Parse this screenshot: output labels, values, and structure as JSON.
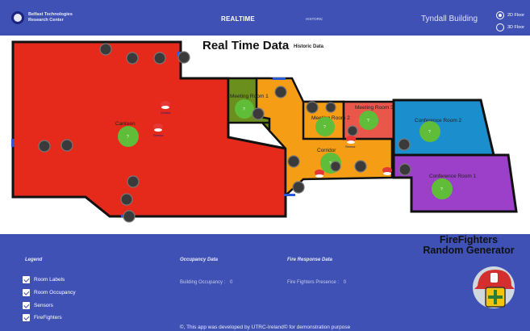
{
  "header": {
    "logo_text": "Belfast Technologies Research Center",
    "nav_realtime": "REALTIME",
    "nav_historic": "HISTORIC",
    "building": "Tyndall Building",
    "view_options": [
      {
        "label": "2D Floor",
        "selected": true
      },
      {
        "label": "3D Floor",
        "selected": false
      }
    ]
  },
  "map": {
    "title": "Real Time Data",
    "subtitle": "Historic Data",
    "rooms": {
      "canteen": {
        "label": "Canteen",
        "color": "#e52a1c"
      },
      "meeting1": {
        "label": "Meeting Room 1",
        "color": "#6a8f1c"
      },
      "meeting2": {
        "label": "Meeting Room 2",
        "color": "#f59d14"
      },
      "meeting3": {
        "label": "Meeting Room 3",
        "color": "#e9564a"
      },
      "corridor": {
        "label": "Corridor",
        "color": "#f59d14"
      },
      "conf2": {
        "label": "Conference Room 2",
        "color": "#1b8fce"
      },
      "conf1": {
        "label": "Conference Room 1",
        "color": "#9c3fc9"
      }
    },
    "occupancy_marker": "?",
    "sensor_labels": {
      "s1": "Smoke",
      "s2": "Sensor",
      "s3": "Sensor"
    }
  },
  "footer": {
    "firefighters_title_1": "FireFighters",
    "firefighters_title_2": "Random Generator",
    "legend_title": "Legend",
    "legend_items": [
      "Room Labels",
      "Room Occupancy",
      "Sensors",
      "FireFighters"
    ],
    "occupancy_title": "Occupancy Data",
    "occupancy_label": "Building Occupancy :",
    "occupancy_value": "0",
    "fire_title": "Fire Response Data",
    "fire_label": "Fire Fighters Presence :",
    "fire_value": "0",
    "credit": "©, This app was developed by UTRC-Ireland© for demonstration purpose"
  }
}
